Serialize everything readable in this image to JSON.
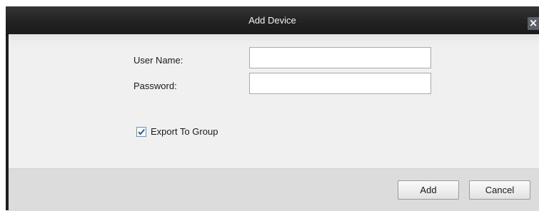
{
  "dialog": {
    "title": "Add Device",
    "close_glyph": "×"
  },
  "form": {
    "username_label": "User Name:",
    "username_value": "",
    "password_label": "Password:",
    "password_value": "",
    "export_to_group_label": "Export To Group",
    "export_to_group_checked": true
  },
  "buttons": {
    "add_label": "Add",
    "cancel_label": "Cancel"
  },
  "colors": {
    "titlebar": "#232323",
    "body": "#f0f0f0",
    "footer": "#dcdcdc",
    "checkbox_accent": "#2a5aa0"
  },
  "icons": {
    "close": "close-icon",
    "check": "checkmark-icon"
  }
}
